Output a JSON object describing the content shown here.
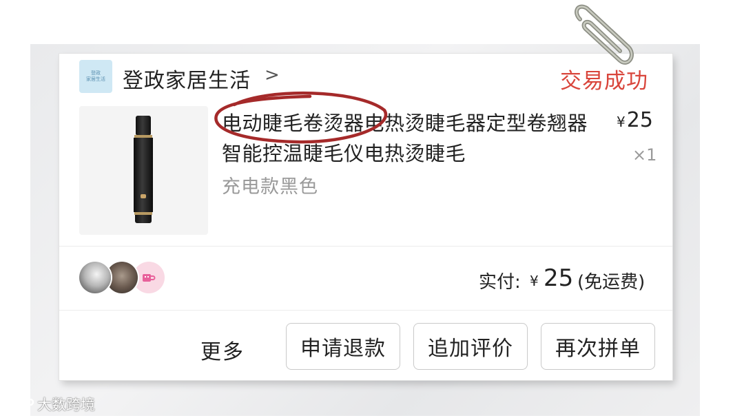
{
  "shop": {
    "logo_text_line1": "登政",
    "logo_text_line2": "家居生活",
    "name": "登政家居生活",
    "chevron": ">"
  },
  "order": {
    "status": "交易成功",
    "status_color": "#d9453b"
  },
  "product": {
    "title": "电动睫毛卷烫器电热烫睫毛器定型卷翘器智能控温睫毛仪电热烫睫毛",
    "spec": "充电款黑色",
    "price_symbol": "¥",
    "price": "25",
    "quantity": "×1"
  },
  "payment": {
    "label": "实付:",
    "symbol": "¥",
    "amount": "25",
    "note": "(免运费)"
  },
  "actions": {
    "more": "更多",
    "refund": "申请退款",
    "review": "追加评价",
    "reorder": "再次拼单"
  },
  "watermark": {
    "text": "大数跨境"
  },
  "icons": {
    "paperclip": "paperclip-icon",
    "mug": "mug-icon",
    "chevron": "chevron-right-icon"
  }
}
